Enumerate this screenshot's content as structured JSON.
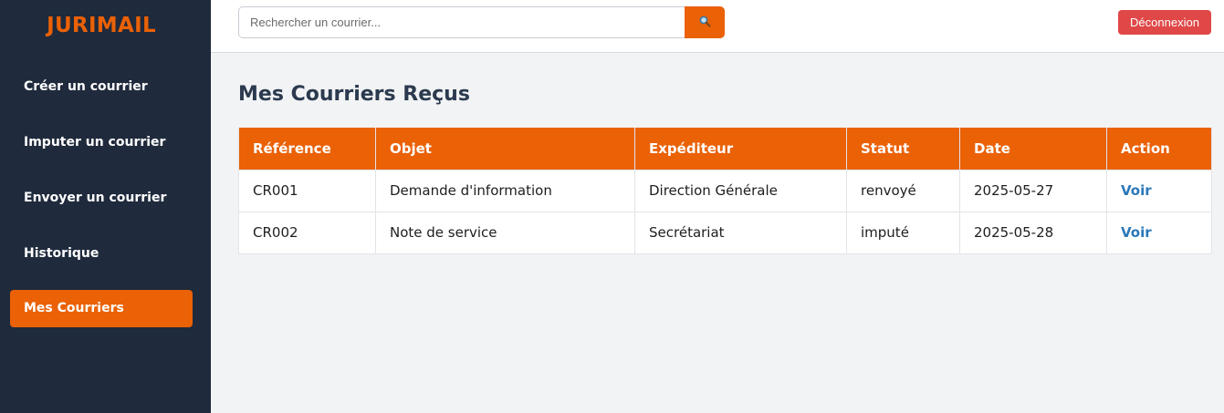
{
  "app": {
    "logo": "JURIMAIL"
  },
  "sidebar": {
    "items": [
      {
        "label": "Créer un courrier"
      },
      {
        "label": "Imputer un courrier"
      },
      {
        "label": "Envoyer un courrier"
      },
      {
        "label": "Historique"
      },
      {
        "label": "Mes Courriers",
        "active": true
      }
    ]
  },
  "topbar": {
    "search": {
      "placeholder": "Rechercher un courrier...",
      "value": "",
      "icon": "magnifier-icon"
    },
    "logout_label": "Déconnexion"
  },
  "main": {
    "title": "Mes Courriers Reçus",
    "table": {
      "headers": [
        "Référence",
        "Objet",
        "Expéditeur",
        "Statut",
        "Date",
        "Action"
      ],
      "rows": [
        {
          "reference": "CR001",
          "objet": "Demande d'information",
          "expediteur": "Direction Générale",
          "statut": "renvoyé",
          "date": "2025-05-27",
          "action": "Voir"
        },
        {
          "reference": "CR002",
          "objet": "Note de service",
          "expediteur": "Secrétariat",
          "statut": "imputé",
          "date": "2025-05-28",
          "action": "Voir"
        }
      ]
    }
  },
  "colors": {
    "accent": "#ea6106",
    "sidebar_bg": "#1f2a3c",
    "logout": "#e04848",
    "link": "#2b78b7",
    "title": "#2b3a4e"
  }
}
